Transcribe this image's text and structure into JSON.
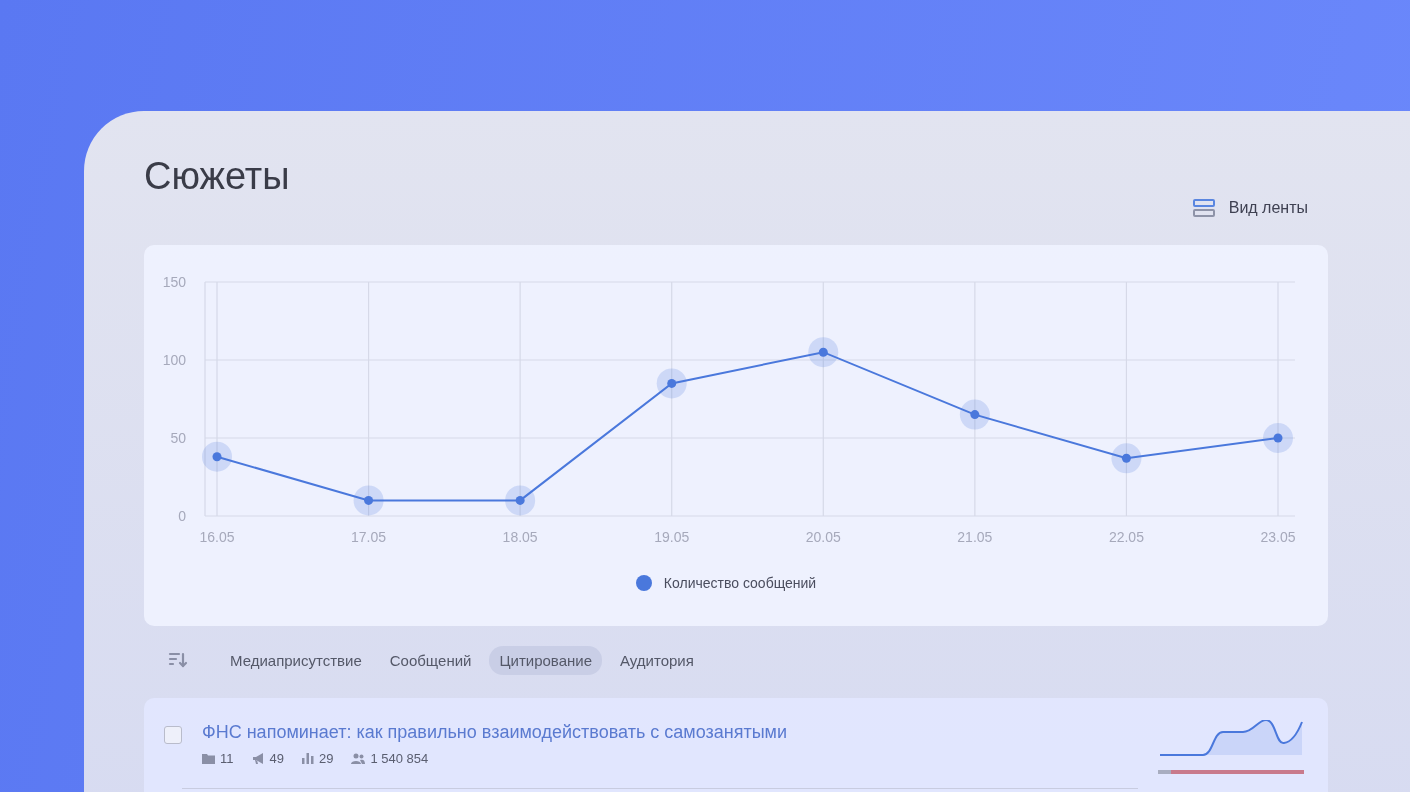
{
  "page": {
    "title": "Сюжеты",
    "view_toggle": {
      "label": "Вид ленты"
    }
  },
  "chart": {
    "chart_data": {
      "type": "line",
      "categories": [
        "16.05",
        "17.05",
        "18.05",
        "19.05",
        "20.05",
        "21.05",
        "22.05",
        "23.05"
      ],
      "series": [
        {
          "name": "Количество сообщений",
          "color": "#4a78dc",
          "marker": true,
          "values": [
            38,
            10,
            10,
            85,
            105,
            65,
            37,
            50
          ]
        }
      ],
      "grid": true,
      "ylim": [
        0,
        150
      ],
      "yticks": [
        0,
        50,
        100,
        150
      ]
    }
  },
  "sort_tabs": [
    {
      "label": "Медиаприсутствие",
      "selected": false
    },
    {
      "label": "Сообщений",
      "selected": false
    },
    {
      "label": "Цитирование",
      "selected": true
    },
    {
      "label": "Аудитория",
      "selected": false
    }
  ],
  "stories": [
    {
      "title": "ФНС напоминает: как правильно взаимодействовать с самозанятыми",
      "checked": false,
      "stats": [
        {
          "kind": "sources",
          "value": "11"
        },
        {
          "kind": "reposts",
          "value": "49"
        },
        {
          "kind": "citation",
          "value": "29"
        },
        {
          "kind": "audience",
          "value": "1 540 854"
        }
      ],
      "tone_bar": {
        "level": 0.09
      }
    }
  ]
}
